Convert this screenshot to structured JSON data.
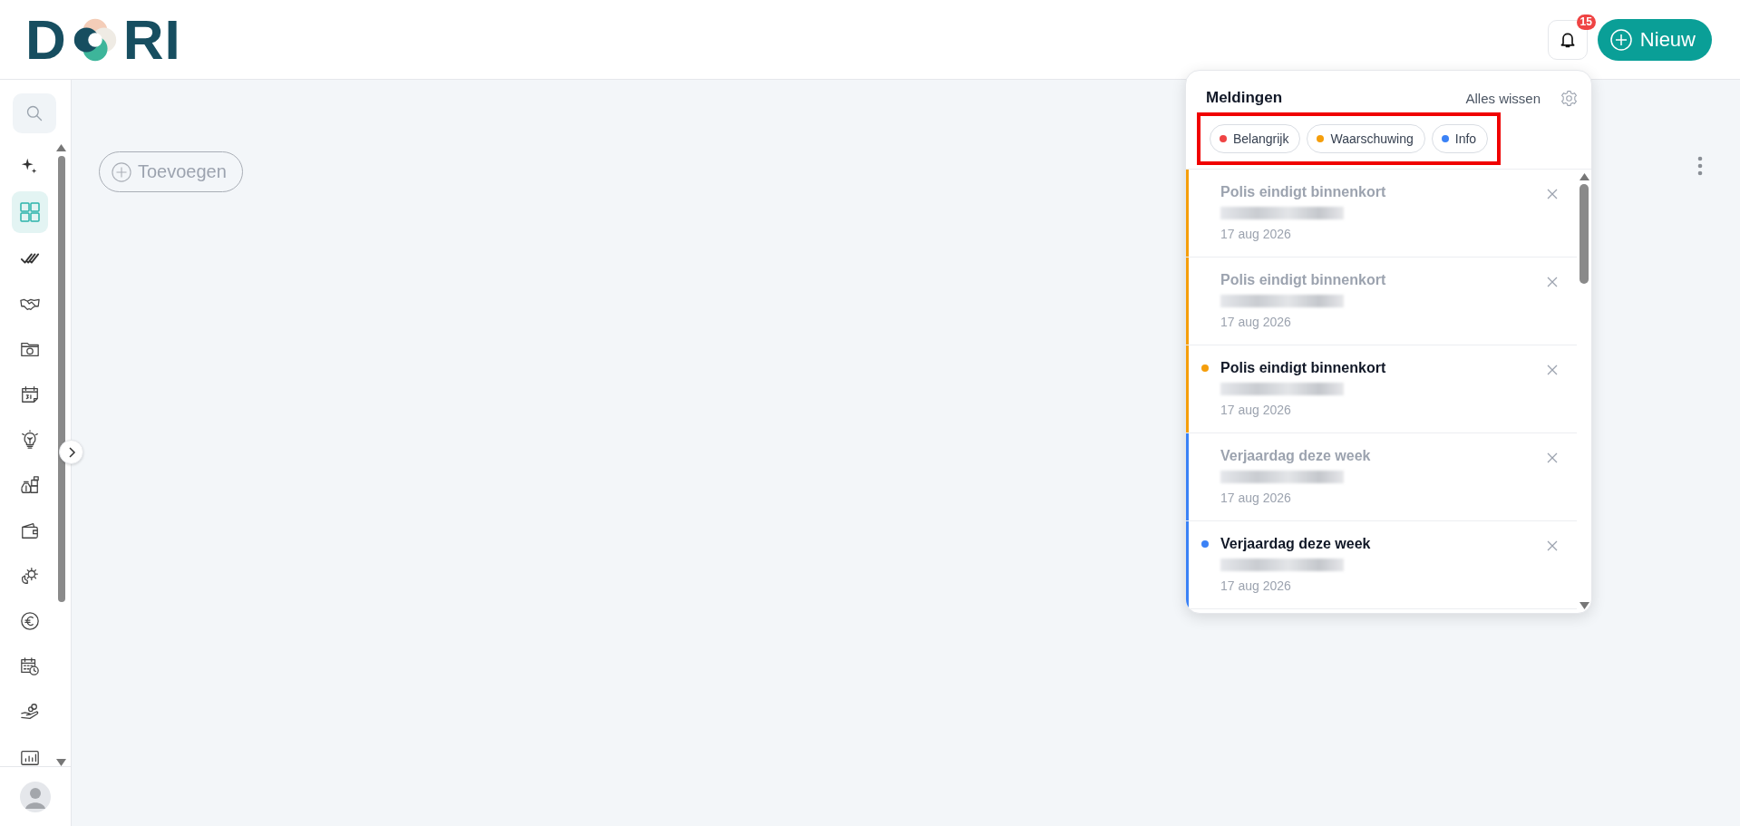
{
  "logo": {
    "text_left": "D",
    "text_right": "RI"
  },
  "header": {
    "badge": "15",
    "new_button": "Nieuw"
  },
  "sidebar": {
    "items": [
      {
        "kind": "sparkle",
        "selected": false
      },
      {
        "kind": "grid",
        "selected": true
      },
      {
        "kind": "checks",
        "selected": false
      },
      {
        "kind": "handshake",
        "selected": false
      },
      {
        "kind": "folder",
        "selected": false
      },
      {
        "kind": "calendar",
        "selected": false
      },
      {
        "kind": "bulb",
        "selected": false
      },
      {
        "kind": "moneybag",
        "selected": false
      },
      {
        "kind": "wallet",
        "selected": false
      },
      {
        "kind": "gear",
        "selected": false
      },
      {
        "kind": "euro",
        "selected": false
      },
      {
        "kind": "calendar-clock",
        "selected": false
      },
      {
        "kind": "hand-coin",
        "selected": false
      },
      {
        "kind": "chart",
        "selected": false
      }
    ]
  },
  "main": {
    "add_button": "Toevoegen"
  },
  "notifications_panel": {
    "title": "Meldingen",
    "clear_all": "Alles wissen",
    "filters_highlighted": true,
    "filters": [
      {
        "label": "Belangrijk",
        "color": "#ef4444"
      },
      {
        "label": "Waarschuwing",
        "color": "#f59e0b"
      },
      {
        "label": "Info",
        "color": "#3b82f6"
      }
    ],
    "items": [
      {
        "title": "Polis eindigt binnenkort",
        "date": "17 aug 2026",
        "read": true,
        "color": "#f59e0b"
      },
      {
        "title": "Polis eindigt binnenkort",
        "date": "17 aug 2026",
        "read": true,
        "color": "#f59e0b"
      },
      {
        "title": "Polis eindigt binnenkort",
        "date": "17 aug 2026",
        "read": false,
        "color": "#f59e0b"
      },
      {
        "title": "Verjaardag deze week",
        "date": "17 aug 2026",
        "read": true,
        "color": "#3b82f6"
      },
      {
        "title": "Verjaardag deze week",
        "date": "17 aug 2026",
        "read": false,
        "color": "#3b82f6"
      }
    ]
  }
}
